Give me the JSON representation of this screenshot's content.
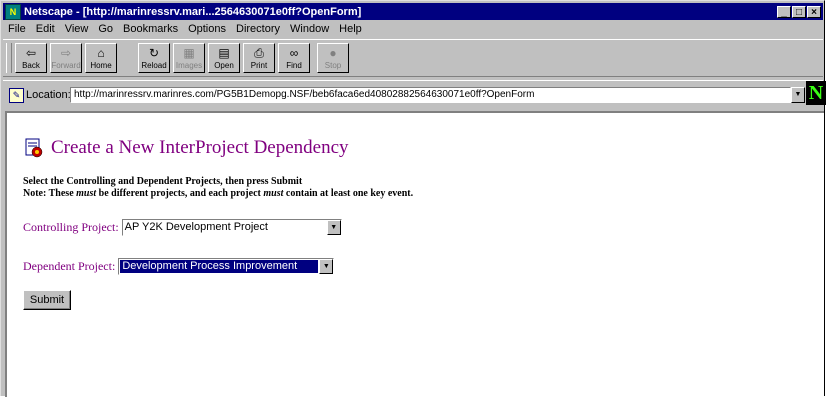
{
  "window": {
    "title": "Netscape - [http://marinressrv.mari...2564630071e0ff?OpenForm]",
    "controls": [
      "_",
      "□",
      "×"
    ]
  },
  "menu": [
    "File",
    "Edit",
    "View",
    "Go",
    "Bookmarks",
    "Options",
    "Directory",
    "Window",
    "Help"
  ],
  "toolbar": {
    "back": "Back",
    "forward": "Forward",
    "home": "Home",
    "reload": "Reload",
    "images": "Images",
    "open": "Open",
    "print": "Print",
    "find": "Find",
    "stop": "Stop"
  },
  "location": {
    "label": "Location:",
    "url": "http://marinressrv.marinres.com/PG5B1Demopg.NSF/beb6faca6ed40802882564630071e0ff?OpenForm"
  },
  "page": {
    "heading": "Create a New InterProject Dependency",
    "instruction_line1": "Select the Controlling and Dependent Projects, then press Submit",
    "instruction_line2_prefix": "Note: These ",
    "instruction_line2_em1": "must",
    "instruction_line2_mid": " be different projects, and each project ",
    "instruction_line2_em2": "must",
    "instruction_line2_suffix": " contain at least one key event.",
    "controlling_label": "Controlling Project:",
    "controlling_value": "AP Y2K Development Project",
    "dependent_label": "Dependent Project:",
    "dependent_value": "Development Process Improvement",
    "submit_label": "Submit"
  },
  "colors": {
    "heading": "#800080",
    "titlebar": "#000080",
    "selection": "#000080"
  }
}
